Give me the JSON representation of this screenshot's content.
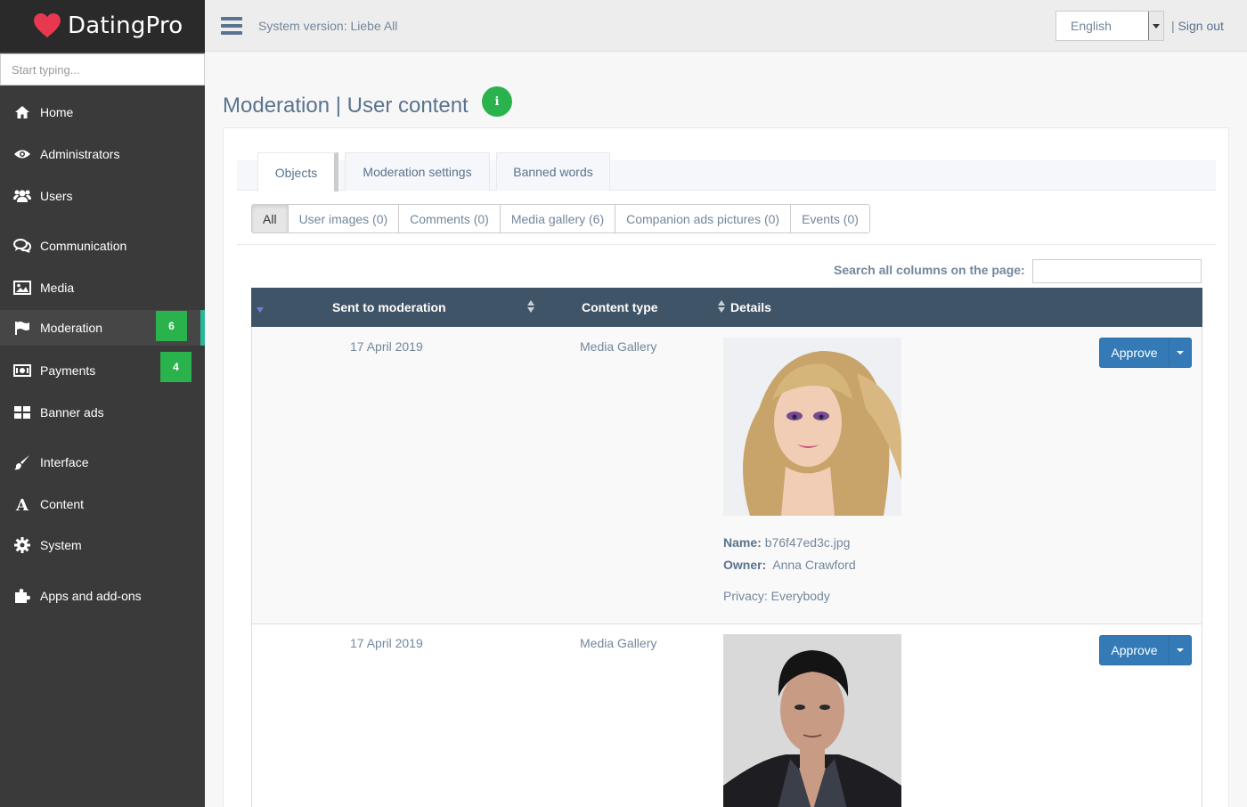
{
  "app": {
    "brand": "DatingPro"
  },
  "sidebar": {
    "search_placeholder": "Start typing...",
    "items": [
      {
        "label": "Home",
        "icon": "home-icon"
      },
      {
        "label": "Administrators",
        "icon": "eye-icon"
      },
      {
        "label": "Users",
        "icon": "users-icon"
      },
      {
        "label": "Communication",
        "icon": "comments-icon"
      },
      {
        "label": "Media",
        "icon": "image-icon"
      },
      {
        "label": "Moderation",
        "icon": "flag-icon",
        "badge": "6",
        "active": true
      },
      {
        "label": "Payments",
        "icon": "money-icon",
        "badge": "4"
      },
      {
        "label": "Banner ads",
        "icon": "grid-icon"
      },
      {
        "label": "Interface",
        "icon": "brush-icon"
      },
      {
        "label": "Content",
        "icon": "font-icon"
      },
      {
        "label": "System",
        "icon": "gear-icon"
      },
      {
        "label": "Apps and add-ons",
        "icon": "puzzle-icon"
      }
    ]
  },
  "topbar": {
    "system_version": "System version: Liebe All",
    "language": "English",
    "separator": "|",
    "sign_out": "Sign out"
  },
  "page": {
    "title": "Moderation | User content",
    "info_icon": "i"
  },
  "tabs": [
    {
      "label": "Objects",
      "active": true
    },
    {
      "label": "Moderation settings"
    },
    {
      "label": "Banned words"
    }
  ],
  "filters": [
    {
      "label": "All",
      "active": true
    },
    {
      "label": "User images (0)"
    },
    {
      "label": "Comments (0)"
    },
    {
      "label": "Media gallery (6)"
    },
    {
      "label": "Companion ads pictures (0)"
    },
    {
      "label": "Events (0)"
    }
  ],
  "table": {
    "search_label": "Search all columns on the page:",
    "columns": [
      "Sent to moderation",
      "Content type",
      "Details"
    ],
    "rows": [
      {
        "date": "17 April 2019",
        "type": "Media Gallery",
        "name_label": "Name:",
        "name": "b76f47ed3c.jpg",
        "owner_label": "Owner:",
        "owner": "Anna Crawford",
        "privacy": "Privacy: Everybody",
        "action": "Approve"
      },
      {
        "date": "17 April 2019",
        "type": "Media Gallery",
        "action": "Approve"
      }
    ]
  },
  "colors": {
    "sidebar_bg": "#3a3a3a",
    "badge_green": "#2ab24d",
    "table_header": "#405467",
    "primary_button": "#337ab7"
  }
}
